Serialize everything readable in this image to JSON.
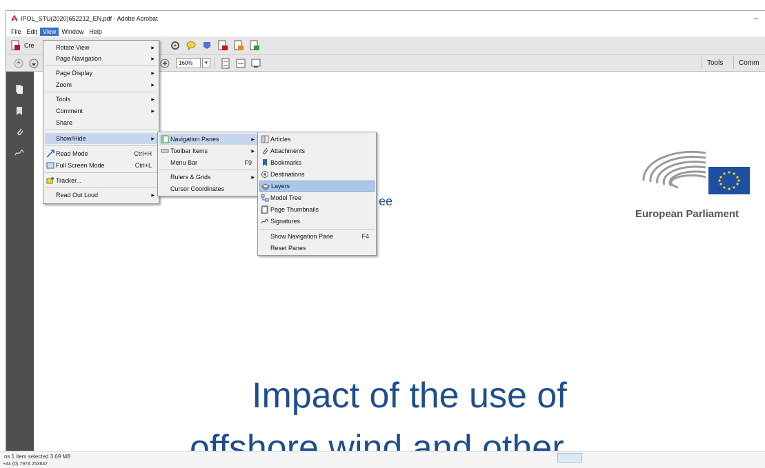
{
  "window": {
    "title": "IPOL_STU(2020)652212_EN.pdf - Adobe Acrobat",
    "minimize_glyph": "–"
  },
  "menubar": {
    "items": [
      "File",
      "Edit",
      "View",
      "Window",
      "Help"
    ]
  },
  "toolbar": {
    "create_label": "Cre",
    "zoom_value": "160%",
    "zoom_dropdown_glyph": "▾",
    "tools_label": "Tools",
    "comment_label": "Comm"
  },
  "view_menu": {
    "rotate_view": "Rotate View",
    "page_navigation": "Page Navigation",
    "page_display": "Page Display",
    "zoom": "Zoom",
    "tools": "Tools",
    "comment": "Comment",
    "share": "Share",
    "show_hide": "Show/Hide",
    "read_mode": "Read Mode",
    "read_mode_shortcut": "Ctrl+H",
    "full_screen_mode": "Full Screen Mode",
    "full_screen_shortcut": "Ctrl+L",
    "tracker": "Tracker...",
    "read_out_loud": "Read Out Loud"
  },
  "show_hide_menu": {
    "navigation_panes": "Navigation Panes",
    "toolbar_items": "Toolbar Items",
    "menu_bar": "Menu Bar",
    "menu_bar_shortcut": "F9",
    "rulers_grids": "Rulers & Grids",
    "cursor_coordinates": "Cursor Coordinates"
  },
  "nav_panes_menu": {
    "articles": "Articles",
    "attachments": "Attachments",
    "bookmarks": "Bookmarks",
    "destinations": "Destinations",
    "layers": "Layers",
    "model_tree": "Model Tree",
    "page_thumbnails": "Page Thumbnails",
    "signatures": "Signatures",
    "show_navigation_pane": "Show Navigation Pane",
    "show_navigation_pane_shortcut": "F4",
    "reset_panes": "Reset Panes"
  },
  "document": {
    "fragment_text": "ee",
    "title_line1": "Impact of the use of",
    "title_line2": "offshore wind and other",
    "logo_text": "European Parliament"
  },
  "statusbar": {
    "line1": "ns    1 item selected  3.69 MB",
    "line2": "+44 (0) 7974 253647"
  },
  "colors": {
    "menu_highlight": "#3a72c4",
    "doc_title": "#1f4e8c",
    "eu_flag": "#1f4fa0",
    "eu_stars": "#f4d21f"
  },
  "icons": {
    "app": "acrobat-icon",
    "create": "create-pdf-icon",
    "nav": [
      "pages-icon",
      "bookmark-icon",
      "attachment-icon",
      "signature-icon"
    ]
  }
}
